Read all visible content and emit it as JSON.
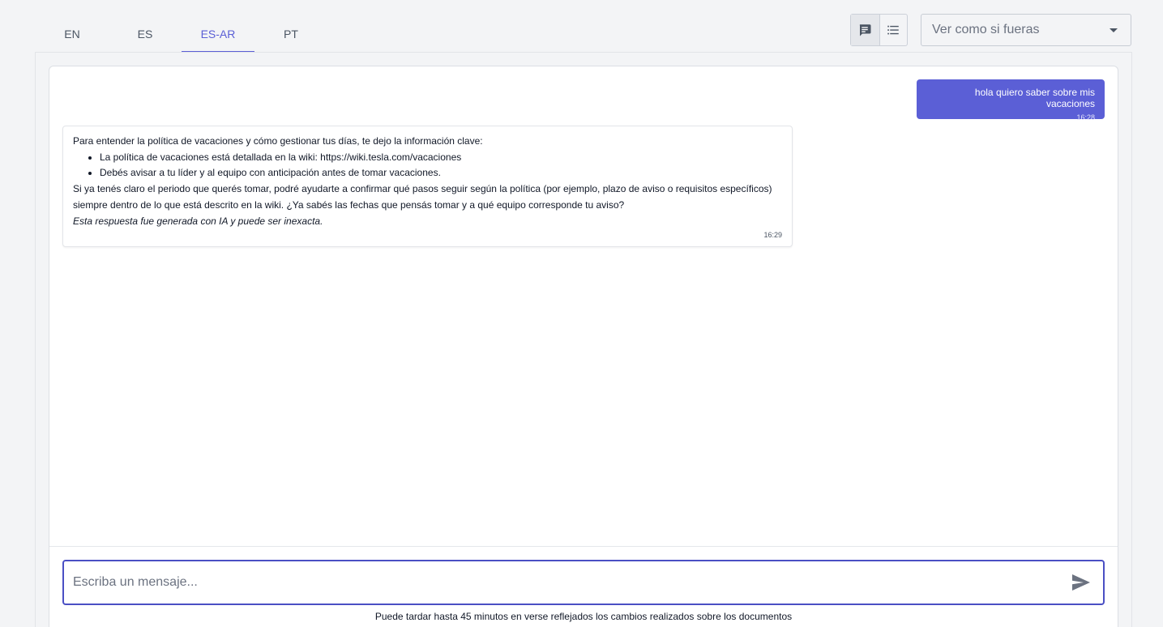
{
  "tabs": [
    {
      "label": "EN",
      "active": false
    },
    {
      "label": "ES",
      "active": false
    },
    {
      "label": "ES-AR",
      "active": true
    },
    {
      "label": "PT",
      "active": false
    }
  ],
  "view_toggle": {
    "chat_icon": "chat-bubble-icon",
    "list_icon": "list-icon"
  },
  "role_select": {
    "placeholder": "Ver como si fueras",
    "icon": "caret-down-icon"
  },
  "conversation": {
    "user_message": {
      "text": "hola quiero saber sobre mis vacaciones",
      "time": "16:28"
    },
    "bot_message": {
      "intro": "Para entender la política de vacaciones y cómo gestionar tus días, te dejo la información clave:",
      "bullets": [
        "La política de vacaciones está detallada en la wiki: https://wiki.tesla.com/vacaciones",
        "Debés avisar a tu líder y al equipo con anticipación antes de tomar vacaciones."
      ],
      "line1": "Si ya tenés claro el periodo que querés tomar, podré ayudarte a confirmar qué pasos seguir según la política (por ejemplo, plazo de aviso o requisitos específicos)",
      "line2": "siempre dentro de lo que está descrito en la wiki. ¿Ya sabés las fechas que pensás tomar y a qué equipo corresponde tu aviso?",
      "disclaimer": "Esta respuesta fue generada con IA y puede ser inexacta.",
      "time": "16:29"
    }
  },
  "composer": {
    "placeholder": "Escriba un mensaje...",
    "send_icon": "send-icon"
  },
  "footnote": "Puede tardar hasta 45 minutos en verse reflejados los cambios realizados sobre los documentos",
  "colors": {
    "accent": "#5b5fd6",
    "background": "#f3f4f6"
  }
}
